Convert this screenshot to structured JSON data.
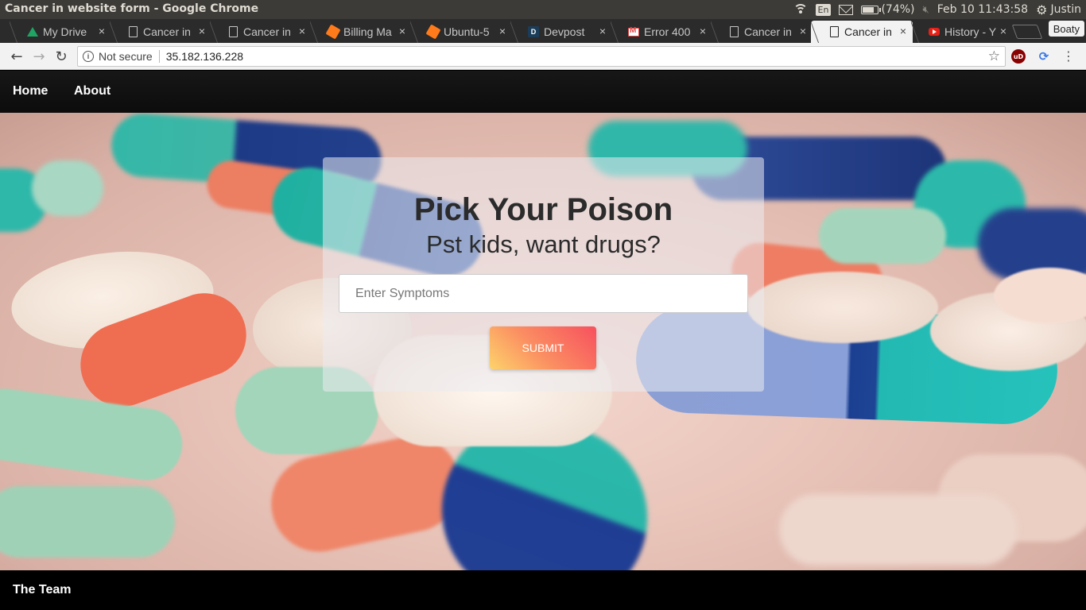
{
  "os": {
    "window_title": "Cancer in website form - Google Chrome",
    "keyboard_layout": "En",
    "battery": "(74%)",
    "battery_level": 0.74,
    "datetime": "Feb 10 11:43:58",
    "user": "Justin"
  },
  "browser": {
    "profile": "Boaty",
    "tabs": [
      {
        "title": "My Drive",
        "favicon": "drive-icon",
        "active": false
      },
      {
        "title": "Cancer in",
        "favicon": "document-icon",
        "active": false
      },
      {
        "title": "Cancer in",
        "favicon": "document-icon",
        "active": false
      },
      {
        "title": "Billing Ma",
        "favicon": "cube-icon",
        "active": false
      },
      {
        "title": "Ubuntu-5",
        "favicon": "cube-icon",
        "active": false
      },
      {
        "title": "Devpost",
        "favicon": "devpost-icon",
        "active": false
      },
      {
        "title": "Error 400",
        "favicon": "gmail-icon",
        "active": false
      },
      {
        "title": "Cancer in",
        "favicon": "document-icon",
        "active": false
      },
      {
        "title": "Cancer in",
        "favicon": "document-icon",
        "active": true
      },
      {
        "title": "History - Y",
        "favicon": "youtube-icon",
        "active": false
      }
    ],
    "security_label": "Not secure",
    "url": "35.182.136.228",
    "extension_ublock": "uD"
  },
  "nav": {
    "home": "Home",
    "about": "About"
  },
  "hero": {
    "title": "Pick Your Poison",
    "subtitle": "Pst kids, want drugs?",
    "input_placeholder": "Enter Symptoms",
    "input_value": "",
    "submit_label": "SUBMIT"
  },
  "footer": {
    "team": "The Team"
  },
  "colors": {
    "nav_bg": "#111111",
    "submit_gradient_start": "#fdd36b",
    "submit_gradient_end": "#f7505e"
  }
}
